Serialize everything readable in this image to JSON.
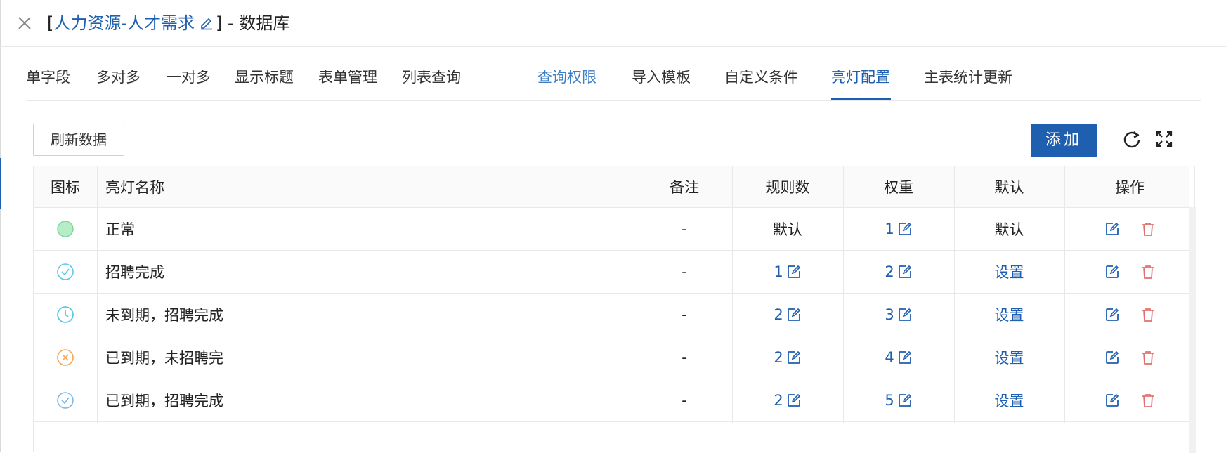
{
  "header": {
    "title_open": "[",
    "title_name": "人力资源-人才需求",
    "title_suffix": "] - 数据库",
    "close_icon": "close-icon",
    "edit_icon": "pen-icon"
  },
  "tabs": [
    {
      "label": "单字段",
      "state": "normal"
    },
    {
      "label": "多对多",
      "state": "normal"
    },
    {
      "label": "一对多",
      "state": "normal"
    },
    {
      "label": "显示标题",
      "state": "normal"
    },
    {
      "label": "表单管理",
      "state": "normal"
    },
    {
      "label": "列表查询",
      "state": "normal"
    },
    {
      "label": "查询权限",
      "state": "visited"
    },
    {
      "label": "导入模板",
      "state": "normal"
    },
    {
      "label": "自定义条件",
      "state": "normal"
    },
    {
      "label": "亮灯配置",
      "state": "active"
    },
    {
      "label": "主表统计更新",
      "state": "normal"
    }
  ],
  "toolbar": {
    "refresh_label": "刷新数据",
    "add_label": "添加",
    "reload_icon": "reload-icon",
    "fullscreen_icon": "fullscreen-icon"
  },
  "table": {
    "columns": [
      "图标",
      "亮灯名称",
      "备注",
      "规则数",
      "权重",
      "默认",
      "操作"
    ],
    "rows": [
      {
        "icon": "green-dot-icon",
        "name": "正常",
        "note": "-",
        "rules": "默认",
        "rules_editable": false,
        "weight": "1",
        "default": "默认",
        "default_is_link": false
      },
      {
        "icon": "check-circle-icon",
        "name": "招聘完成",
        "note": "-",
        "rules": "1",
        "rules_editable": true,
        "weight": "2",
        "default": "设置",
        "default_is_link": true
      },
      {
        "icon": "clock-icon",
        "name": "未到期，招聘完成",
        "note": "-",
        "rules": "2",
        "rules_editable": true,
        "weight": "3",
        "default": "设置",
        "default_is_link": true
      },
      {
        "icon": "close-circle-icon",
        "name": "已到期，未招聘完",
        "note": "-",
        "rules": "2",
        "rules_editable": true,
        "weight": "4",
        "default": "设置",
        "default_is_link": true
      },
      {
        "icon": "check-circle-icon",
        "name": "已到期，招聘完成",
        "note": "-",
        "rules": "2",
        "rules_editable": true,
        "weight": "5",
        "default": "设置",
        "default_is_link": true
      }
    ]
  },
  "colors": {
    "primary": "#1f5fb0",
    "delete": "#e0706f",
    "green": "#7fd8a0",
    "cyan": "#5bc8ea",
    "orange": "#f2a65a"
  }
}
